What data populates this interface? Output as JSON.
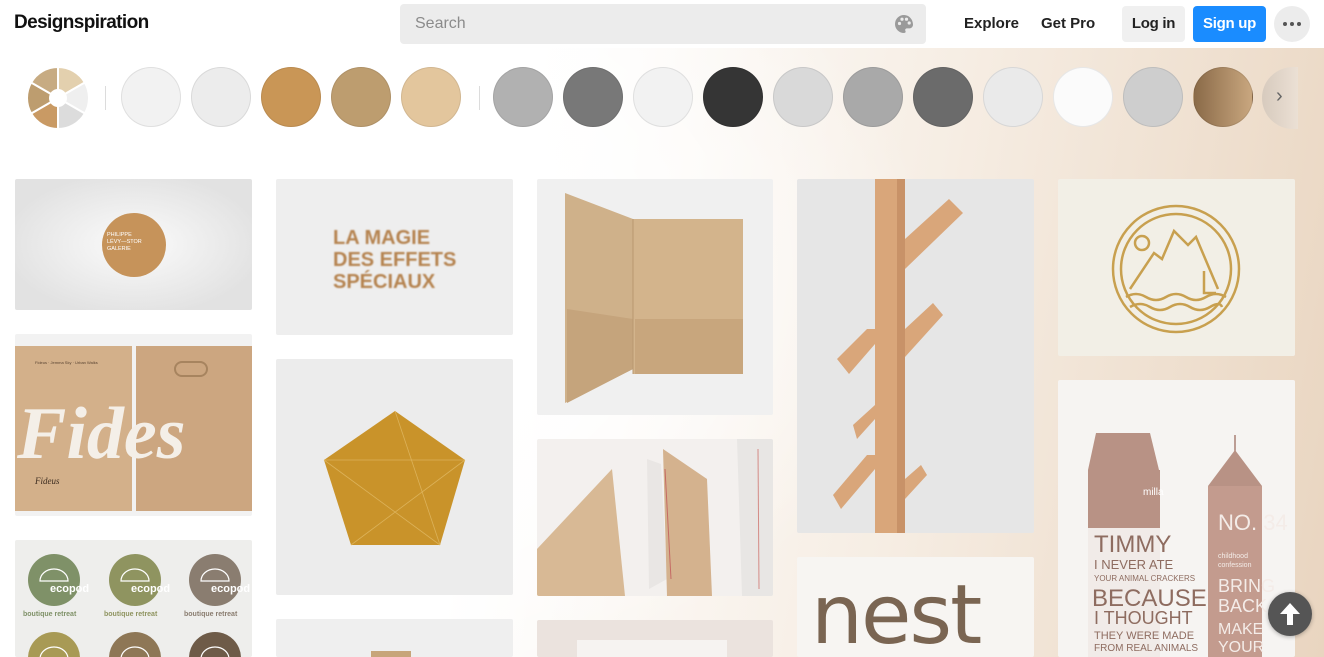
{
  "header": {
    "logo": "Designspiration",
    "search": {
      "placeholder": "Search"
    },
    "nav": {
      "explore": "Explore",
      "get_pro": "Get Pro"
    },
    "login_label": "Log in",
    "signup_label": "Sign up",
    "more_icon": "more-horizontal-icon"
  },
  "color_filter": {
    "wheel_colors": [
      "#e3d0ae",
      "#efefef",
      "#dcdcdc",
      "#c99a64",
      "#bd9d6f",
      "#c7ab82"
    ],
    "swatches": [
      "#f2f2f2",
      "#ececec",
      "#c99656",
      "#bd9d6f",
      "#e3c69d",
      "#b1b1b1",
      "#787878",
      "#f2f2f2",
      "#353535",
      "#d9d9d9",
      "#a9a9a9",
      "#6b6b6b",
      "#eaeaea",
      "#fbfbfb",
      "#cecece",
      "#8a6a48"
    ],
    "next_icon": "chevron-right-icon"
  },
  "cards": {
    "circle_logo_lines": [
      "PHILIPPE",
      "LÉVY—STOR",
      "GALERIE"
    ],
    "poster_lines": [
      "LA MAGIE",
      "DES EFFETS",
      "SPÉCIAUX"
    ],
    "box_script": "Fides",
    "box_brand": "Fideus",
    "ecopod_brand": "ecopod",
    "ecopod_tagline": "boutique retreat",
    "nest_word": "nest",
    "carton_brand": "milla",
    "carton_quote_lines": [
      "TIMMY",
      "I NEVER ATE",
      "YOUR ANIMAL CRACKERS",
      "BECAUSE",
      "I THOUGHT",
      "THEY WERE MADE",
      "FROM REAL ANIMALS"
    ],
    "carton2_number": "NO. 34",
    "carton2_lines": [
      "childhood",
      "confession",
      "BRING",
      "BACK",
      "MAKE",
      "YOUR"
    ]
  },
  "fab": {
    "icon": "arrow-up-icon"
  }
}
